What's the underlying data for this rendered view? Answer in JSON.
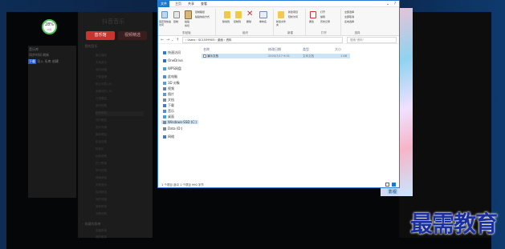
{
  "background_app": {
    "brand": "抖音音乐",
    "tab_active": "音乐馆",
    "tab_inactive": "视频精选",
    "section_1": "· 我的音乐",
    "section_2": "· 收藏的歌单",
    "rows": [
      "最近播放",
      "本地音乐",
      "我的收藏",
      "下载管理",
      "默认列表 (8)",
      "我喜欢的 (3)",
      "日语歌曲",
      "常听的歌",
      "欧美歌曲",
      "流行歌曲",
      "音乐专辑",
      "最新歌曲",
      "民谣合集",
      "轻音乐",
      "经典老歌",
      "热门歌单",
      "梦中的歌",
      "夜晚单曲",
      "车载音乐",
      "摇滚精选",
      "我的收藏",
      "清新歌单",
      "安静的歌"
    ],
    "rows_2": [
      "收藏歌单",
      "我的歌单"
    ]
  },
  "popup": {
    "line1": "音乐库",
    "line2": "同步时间 刷新",
    "btn_a": "下载",
    "btn_b": "导入 乐库 创建"
  },
  "badge": {
    "value": "28%",
    "label": "内存"
  },
  "explorer": {
    "tabs": [
      "文件",
      "主页",
      "共享",
      "查看"
    ],
    "groups": {
      "clipboard": "剪贴板",
      "organize": "组织",
      "new": "新建",
      "open": "打开",
      "select": "选择"
    },
    "buttons": {
      "pin": "固定到快速访问",
      "copy": "复制",
      "paste": "粘贴",
      "cut": "剪切",
      "copy_path": "复制路径",
      "paste_shortcut": "粘贴快捷方式",
      "move_to": "移动到",
      "copy_to": "复制到",
      "delete": "删除",
      "rename": "重命名",
      "new_folder": "新建文件夹",
      "new_item": "新建项目",
      "easy_access": "轻松访问",
      "properties": "属性",
      "open": "打开",
      "edit": "编辑",
      "history": "历史记录",
      "select_all": "全部选择",
      "select_none": "全部取消",
      "invert": "反向选择"
    },
    "address": "›  Users › SC1539903 › 桌面 › 资料",
    "search_placeholder": "搜索\"资料\"",
    "nav_items": [
      "快速访问",
      "OneDrive",
      "WPS网盘",
      "此电脑",
      "3D 对象",
      "视频",
      "图片",
      "文档",
      "下载",
      "音乐",
      "桌面",
      "Windows-SSD (C:)",
      "Data (D:)",
      "网络"
    ],
    "columns": [
      "名称",
      "修改日期",
      "类型",
      "大小"
    ],
    "files": [
      {
        "name": "演示文档",
        "date": "2020/7/17 9:01",
        "type": "文本文档",
        "size": "1 KB"
      }
    ],
    "status": "1 个项目  选中 1 个项目  990 字节"
  },
  "art_label": "影视",
  "watermark": "最需教育",
  "colors": {
    "accent": "#1979ca",
    "selection": "#cce4f7",
    "app_red": "#c8342e",
    "watermark": "#1a2fa0"
  }
}
